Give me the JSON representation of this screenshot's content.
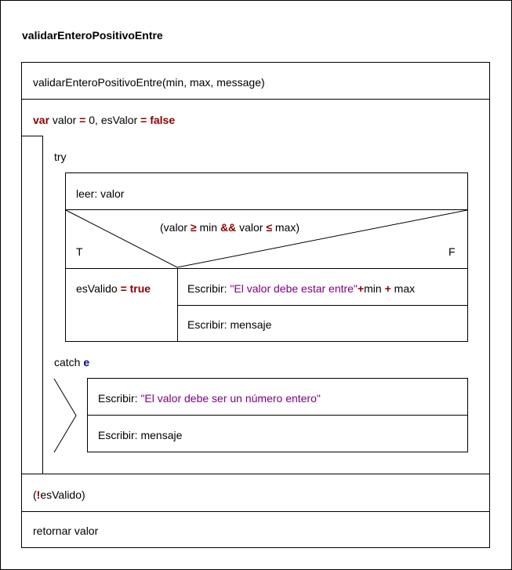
{
  "title": "validarEnteroPositivoEntre",
  "header": {
    "signature": "validarEnteroPositivoEntre(min, max, message)"
  },
  "declaration": {
    "kw_var": "var",
    "name1": "valor",
    "eq1": "=",
    "val1": "0, esValor",
    "eq2": "=",
    "val2": "false"
  },
  "try_block": {
    "label": "try",
    "read_kw": "leer:",
    "read_var": "valor",
    "condition": {
      "open": "(valor",
      "ge": "≥",
      "min": "min",
      "and": "&&",
      "valor2": "valor",
      "le": "≤",
      "max": "max)"
    },
    "true_label": "T",
    "false_label": "F",
    "true_branch": {
      "var": "esValido",
      "eq": "=",
      "val": "true"
    },
    "false_branch": {
      "line1": {
        "kw": "Escribir:",
        "str": "\"El valor debe estar entre\"",
        "plus1": "+",
        "min": "min",
        "plus2": "+",
        "max": "max"
      },
      "line2": {
        "kw": "Escribir:",
        "var": "mensaje"
      }
    }
  },
  "catch_block": {
    "label": "catch",
    "var": "e",
    "line1": {
      "kw": "Escribir:",
      "str": "\"El valor debe ser un número entero\""
    },
    "line2": {
      "kw": "Escribir:",
      "var": "mensaje"
    }
  },
  "loop_condition": {
    "open": "(",
    "not": "!",
    "rest": "esValido)"
  },
  "return_statement": "retornar valor"
}
